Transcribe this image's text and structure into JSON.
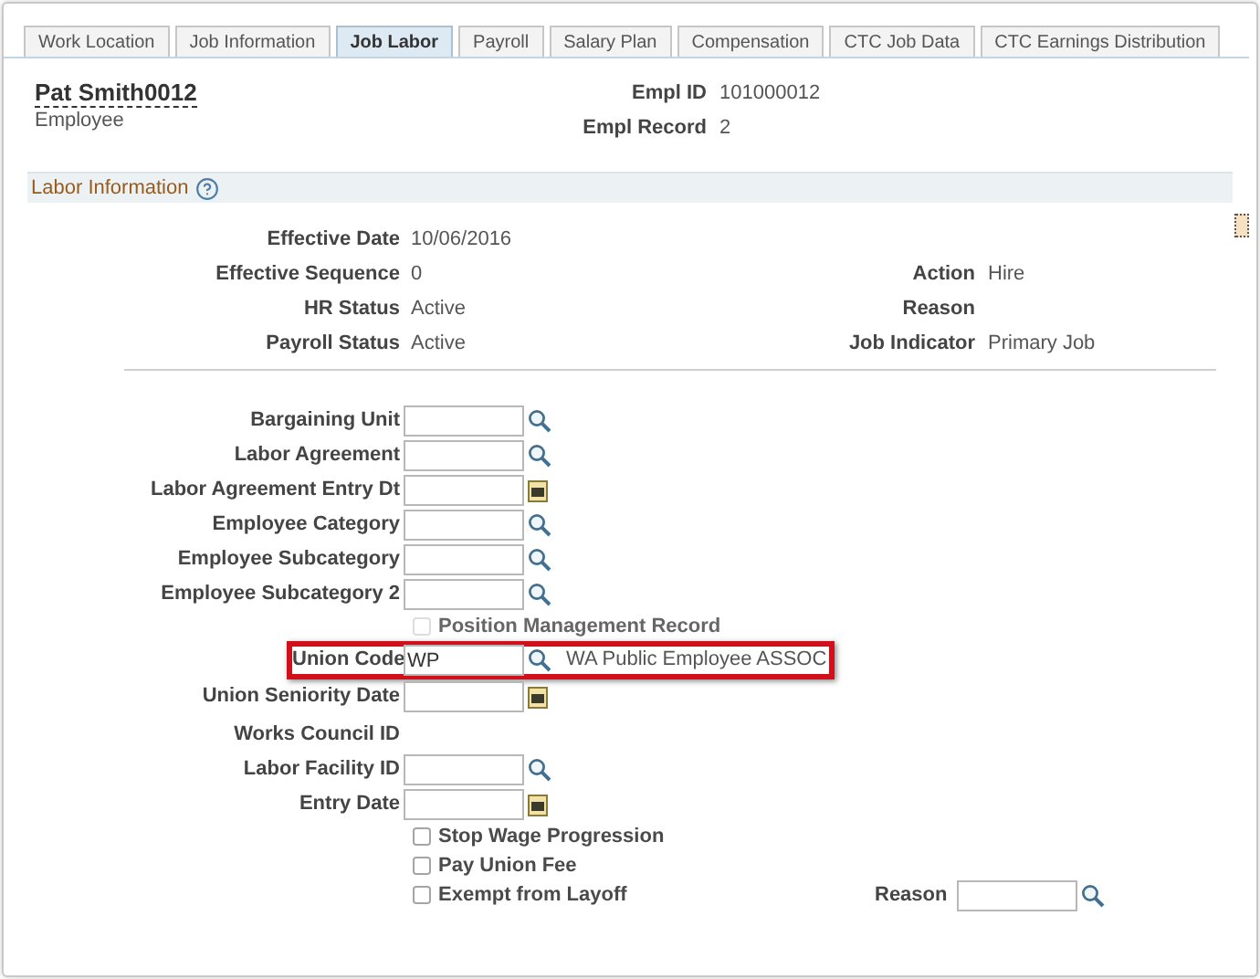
{
  "tabs": [
    {
      "label": "Work Location",
      "selected": false
    },
    {
      "label": "Job Information",
      "selected": false
    },
    {
      "label": "Job Labor",
      "selected": true
    },
    {
      "label": "Payroll",
      "selected": false
    },
    {
      "label": "Salary Plan",
      "selected": false
    },
    {
      "label": "Compensation",
      "selected": false
    },
    {
      "label": "CTC Job Data",
      "selected": false
    },
    {
      "label": "CTC Earnings Distribution",
      "selected": false
    }
  ],
  "header": {
    "name": "Pat Smith0012",
    "role": "Employee",
    "items": [
      {
        "label": "Empl ID",
        "value": "101000012"
      },
      {
        "label": "Empl Record",
        "value": "2"
      }
    ]
  },
  "section": {
    "title": "Labor Information"
  },
  "summary": [
    {
      "left": {
        "label": "Effective Date",
        "value": "10/06/2016"
      }
    },
    {
      "left": {
        "label": "Effective Sequence",
        "value": "0"
      },
      "right": {
        "label": "Action",
        "value": "Hire"
      }
    },
    {
      "left": {
        "label": "HR Status",
        "value": "Active"
      },
      "right": {
        "label": "Reason"
      }
    },
    {
      "left": {
        "label": "Payroll Status",
        "value": "Active"
      },
      "right": {
        "label": "Job Indicator",
        "value": "Primary Job"
      }
    }
  ],
  "fields": [
    {
      "kind": "lookup",
      "label": "Bargaining Unit",
      "highlighted": false
    },
    {
      "kind": "lookup",
      "label": "Labor Agreement",
      "highlighted": false
    },
    {
      "kind": "date",
      "label": "Labor Agreement Entry Dt",
      "highlighted": false
    },
    {
      "kind": "lookup",
      "label": "Employee Category",
      "highlighted": false
    },
    {
      "kind": "lookup",
      "label": "Employee Subcategory",
      "highlighted": false
    },
    {
      "kind": "lookup",
      "label": "Employee Subcategory 2",
      "highlighted": false
    },
    {
      "kind": "checkbox",
      "label": "Position Management Record",
      "checked": false,
      "disabled": true
    },
    {
      "kind": "lookup",
      "label": "Union Code",
      "value": "WP",
      "description": "WA Public Employee ASSOC",
      "highlighted": true
    },
    {
      "kind": "date",
      "label": "Union Seniority Date",
      "highlighted": false
    },
    {
      "kind": "label",
      "label": "Works Council ID"
    },
    {
      "kind": "lookup",
      "label": "Labor Facility ID",
      "highlighted": false
    },
    {
      "kind": "date",
      "label": "Entry Date",
      "highlighted": false
    },
    {
      "kind": "checkbox",
      "label": "Stop Wage Progression",
      "checked": false,
      "disabled": false
    },
    {
      "kind": "checkbox",
      "label": "Pay Union Fee",
      "checked": false,
      "disabled": false
    },
    {
      "kind": "checkbox",
      "label": "Exempt from Layoff",
      "checked": false,
      "disabled": false,
      "side_field": {
        "kind": "lookup",
        "label": "Reason"
      }
    }
  ]
}
